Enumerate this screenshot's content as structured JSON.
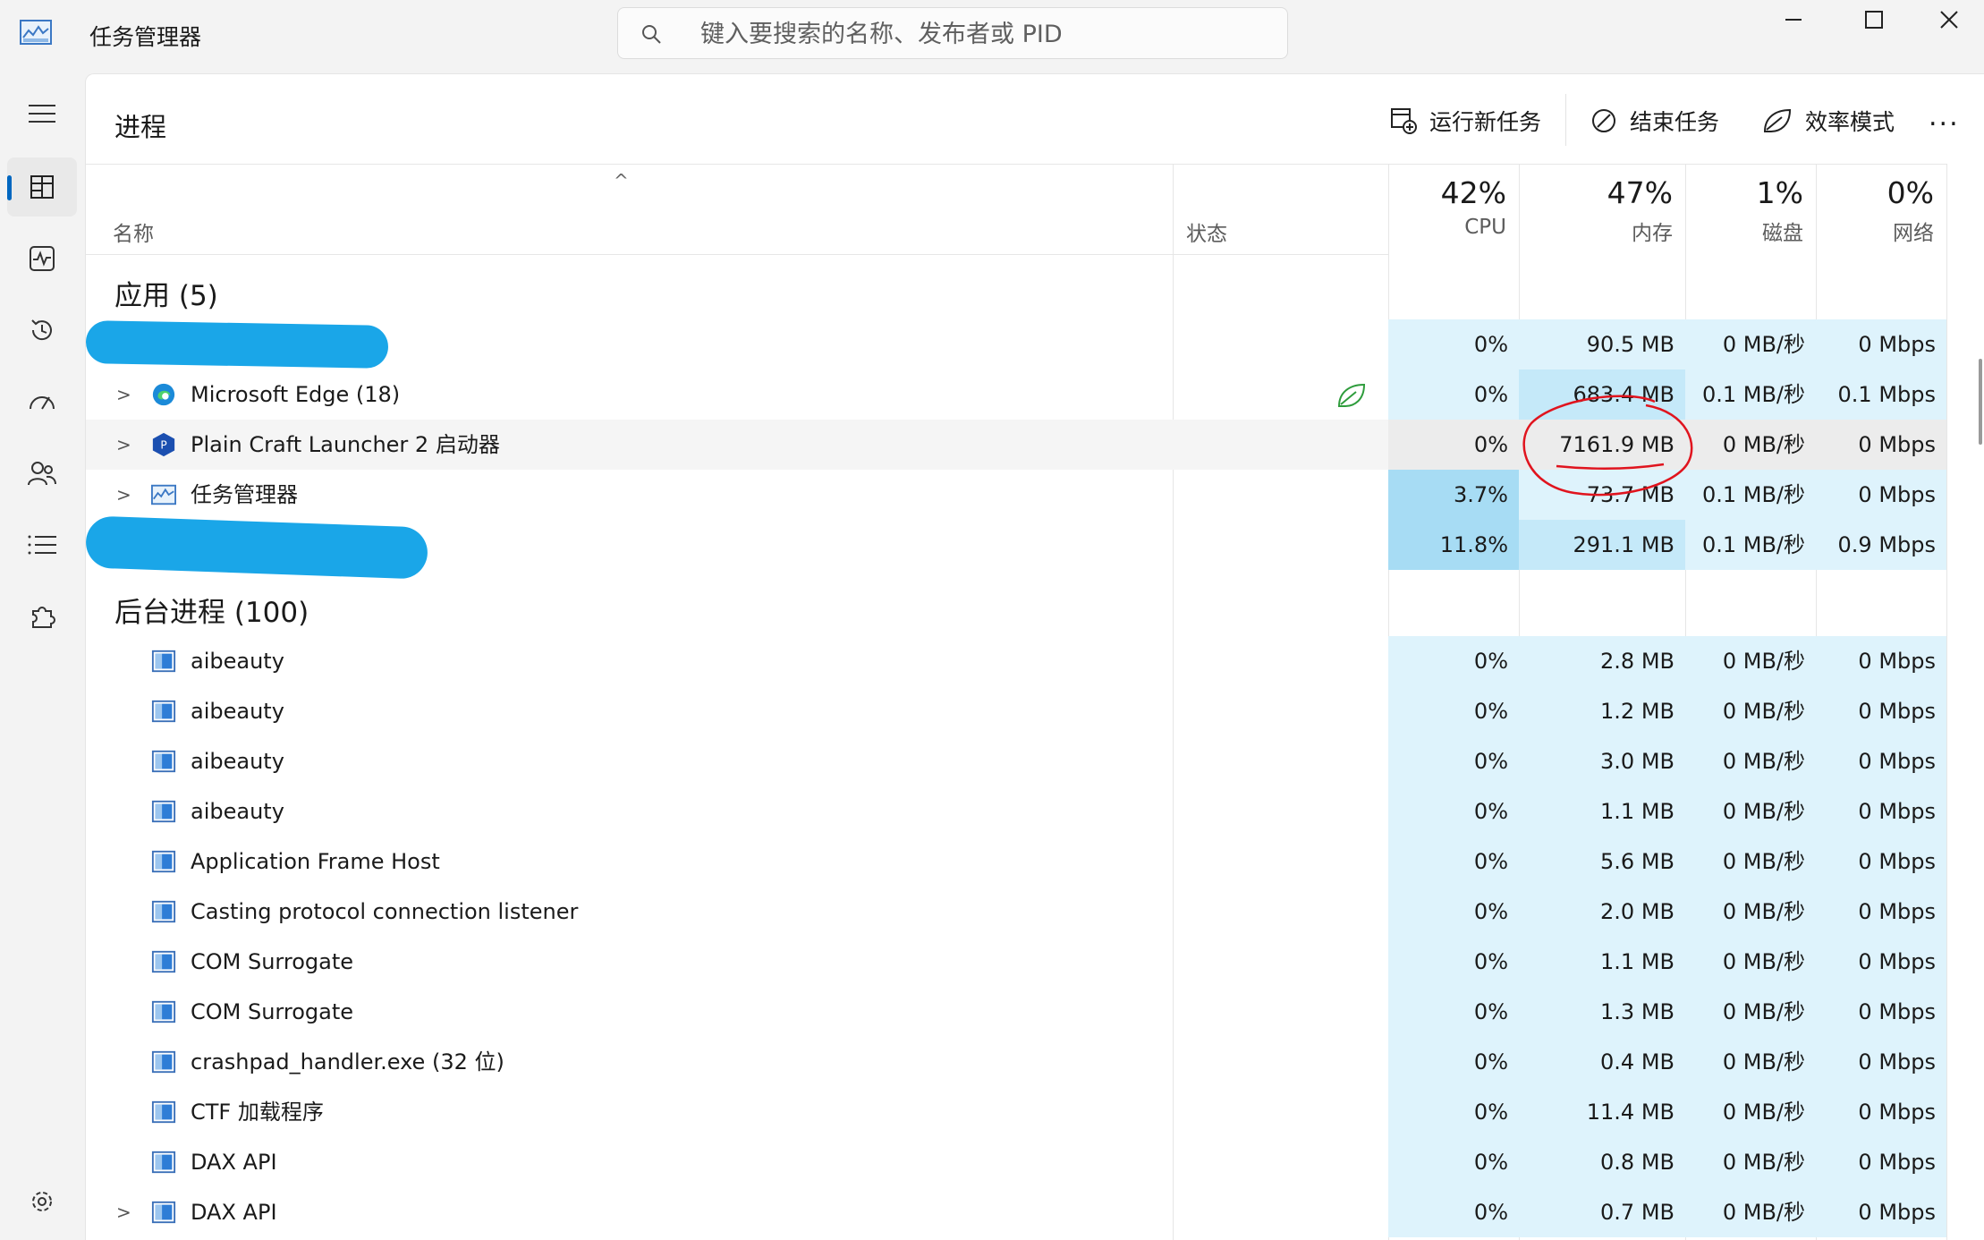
{
  "window": {
    "title": "任务管理器",
    "search_placeholder": "键入要搜索的名称、发布者或 PID"
  },
  "toolbar": {
    "page_title": "进程",
    "run_new_task": "运行新任务",
    "end_task": "结束任务",
    "efficiency_mode": "效率模式",
    "more": "..."
  },
  "header": {
    "name": "名称",
    "status": "状态",
    "cpu_pct": "42%",
    "cpu": "CPU",
    "mem_pct": "47%",
    "mem": "内存",
    "disk_pct": "1%",
    "disk": "磁盘",
    "net_pct": "0%",
    "net": "网络"
  },
  "groups": {
    "apps": "应用 (5)",
    "background": "后台进程 (100)"
  },
  "apps": [
    {
      "name": "",
      "cpu": "0%",
      "mem": "90.5 MB",
      "disk": "0 MB/秒",
      "net": "0 Mbps"
    },
    {
      "name": "Microsoft Edge (18)",
      "cpu": "0%",
      "mem": "683.4 MB",
      "disk": "0.1 MB/秒",
      "net": "0.1 Mbps"
    },
    {
      "name": "Plain Craft Launcher 2 启动器",
      "cpu": "0%",
      "mem": "7161.9 MB",
      "disk": "0 MB/秒",
      "net": "0 Mbps"
    },
    {
      "name": "任务管理器",
      "cpu": "3.7%",
      "mem": "73.7 MB",
      "disk": "0.1 MB/秒",
      "net": "0 Mbps"
    },
    {
      "name": "",
      "cpu": "11.8%",
      "mem": "291.1 MB",
      "disk": "0.1 MB/秒",
      "net": "0.9 Mbps"
    }
  ],
  "background": [
    {
      "name": "aibeauty",
      "cpu": "0%",
      "mem": "2.8 MB",
      "disk": "0 MB/秒",
      "net": "0 Mbps"
    },
    {
      "name": "aibeauty",
      "cpu": "0%",
      "mem": "1.2 MB",
      "disk": "0 MB/秒",
      "net": "0 Mbps"
    },
    {
      "name": "aibeauty",
      "cpu": "0%",
      "mem": "3.0 MB",
      "disk": "0 MB/秒",
      "net": "0 Mbps"
    },
    {
      "name": "aibeauty",
      "cpu": "0%",
      "mem": "1.1 MB",
      "disk": "0 MB/秒",
      "net": "0 Mbps"
    },
    {
      "name": "Application Frame Host",
      "cpu": "0%",
      "mem": "5.6 MB",
      "disk": "0 MB/秒",
      "net": "0 Mbps"
    },
    {
      "name": "Casting protocol connection listener",
      "cpu": "0%",
      "mem": "2.0 MB",
      "disk": "0 MB/秒",
      "net": "0 Mbps"
    },
    {
      "name": "COM Surrogate",
      "cpu": "0%",
      "mem": "1.1 MB",
      "disk": "0 MB/秒",
      "net": "0 Mbps"
    },
    {
      "name": "COM Surrogate",
      "cpu": "0%",
      "mem": "1.3 MB",
      "disk": "0 MB/秒",
      "net": "0 Mbps"
    },
    {
      "name": "crashpad_handler.exe (32 位)",
      "cpu": "0%",
      "mem": "0.4 MB",
      "disk": "0 MB/秒",
      "net": "0 Mbps"
    },
    {
      "name": "CTF 加载程序",
      "cpu": "0%",
      "mem": "11.4 MB",
      "disk": "0 MB/秒",
      "net": "0 Mbps"
    },
    {
      "name": "DAX API",
      "cpu": "0%",
      "mem": "0.8 MB",
      "disk": "0 MB/秒",
      "net": "0 Mbps"
    },
    {
      "name": "DAX API",
      "cpu": "0%",
      "mem": "0.7 MB",
      "disk": "0 MB/秒",
      "net": "0 Mbps"
    }
  ],
  "colors": {
    "heat_light": "#def3fc",
    "heat_mid": "#c5e9f9",
    "heat_strong": "#a7dcf4",
    "redaction": "#1aa6e8",
    "annotation": "#e0141e",
    "accent": "#0067c0"
  }
}
